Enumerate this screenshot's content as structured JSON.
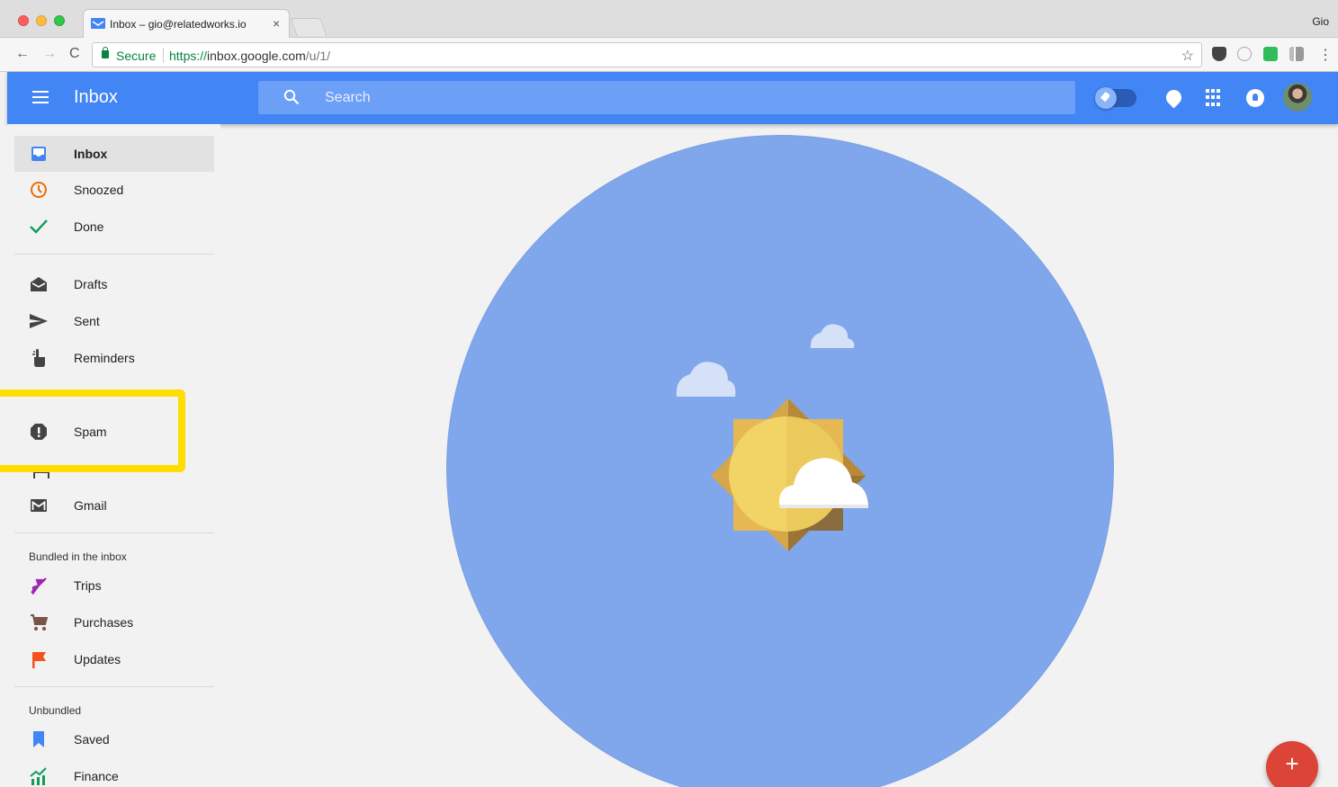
{
  "browser": {
    "tab_title": "Inbox – gio@relatedworks.io",
    "tab_close": "×",
    "profile": "Gio",
    "secure_label": "Secure",
    "url_scheme": "https://",
    "url_host": "inbox.google.com",
    "url_path": "/u/1/",
    "back_glyph": "←",
    "forward_glyph": "→",
    "reload_glyph": "C",
    "star_glyph": "☆",
    "menu_glyph": "⋮"
  },
  "header": {
    "title": "Inbox",
    "search_placeholder": "Search",
    "accent_color": "#4285f4"
  },
  "sidebar": {
    "items_top": [
      {
        "label": "Inbox",
        "icon": "inbox-icon",
        "active": true
      },
      {
        "label": "Snoozed",
        "icon": "clock-icon"
      },
      {
        "label": "Done",
        "icon": "check-icon"
      }
    ],
    "items_mid": [
      {
        "label": "Drafts",
        "icon": "drafts-icon"
      },
      {
        "label": "Sent",
        "icon": "send-icon"
      },
      {
        "label": "Reminders",
        "icon": "reminder-hand-icon"
      },
      {
        "label": "Spam",
        "icon": "spam-icon"
      },
      {
        "label": "Gmail",
        "icon": "gmail-icon"
      }
    ],
    "bundled_label": "Bundled in the inbox",
    "bundled": [
      {
        "label": "Trips",
        "icon": "plane-icon"
      },
      {
        "label": "Purchases",
        "icon": "cart-icon"
      },
      {
        "label": "Updates",
        "icon": "flag-icon"
      }
    ],
    "unbundled_label": "Unbundled",
    "unbundled": [
      {
        "label": "Saved",
        "icon": "bookmark-icon"
      },
      {
        "label": "Finance",
        "icon": "finance-icon"
      }
    ]
  },
  "fab": {
    "label": "+",
    "color": "#db4437"
  },
  "highlight_color": "#ffdd00"
}
